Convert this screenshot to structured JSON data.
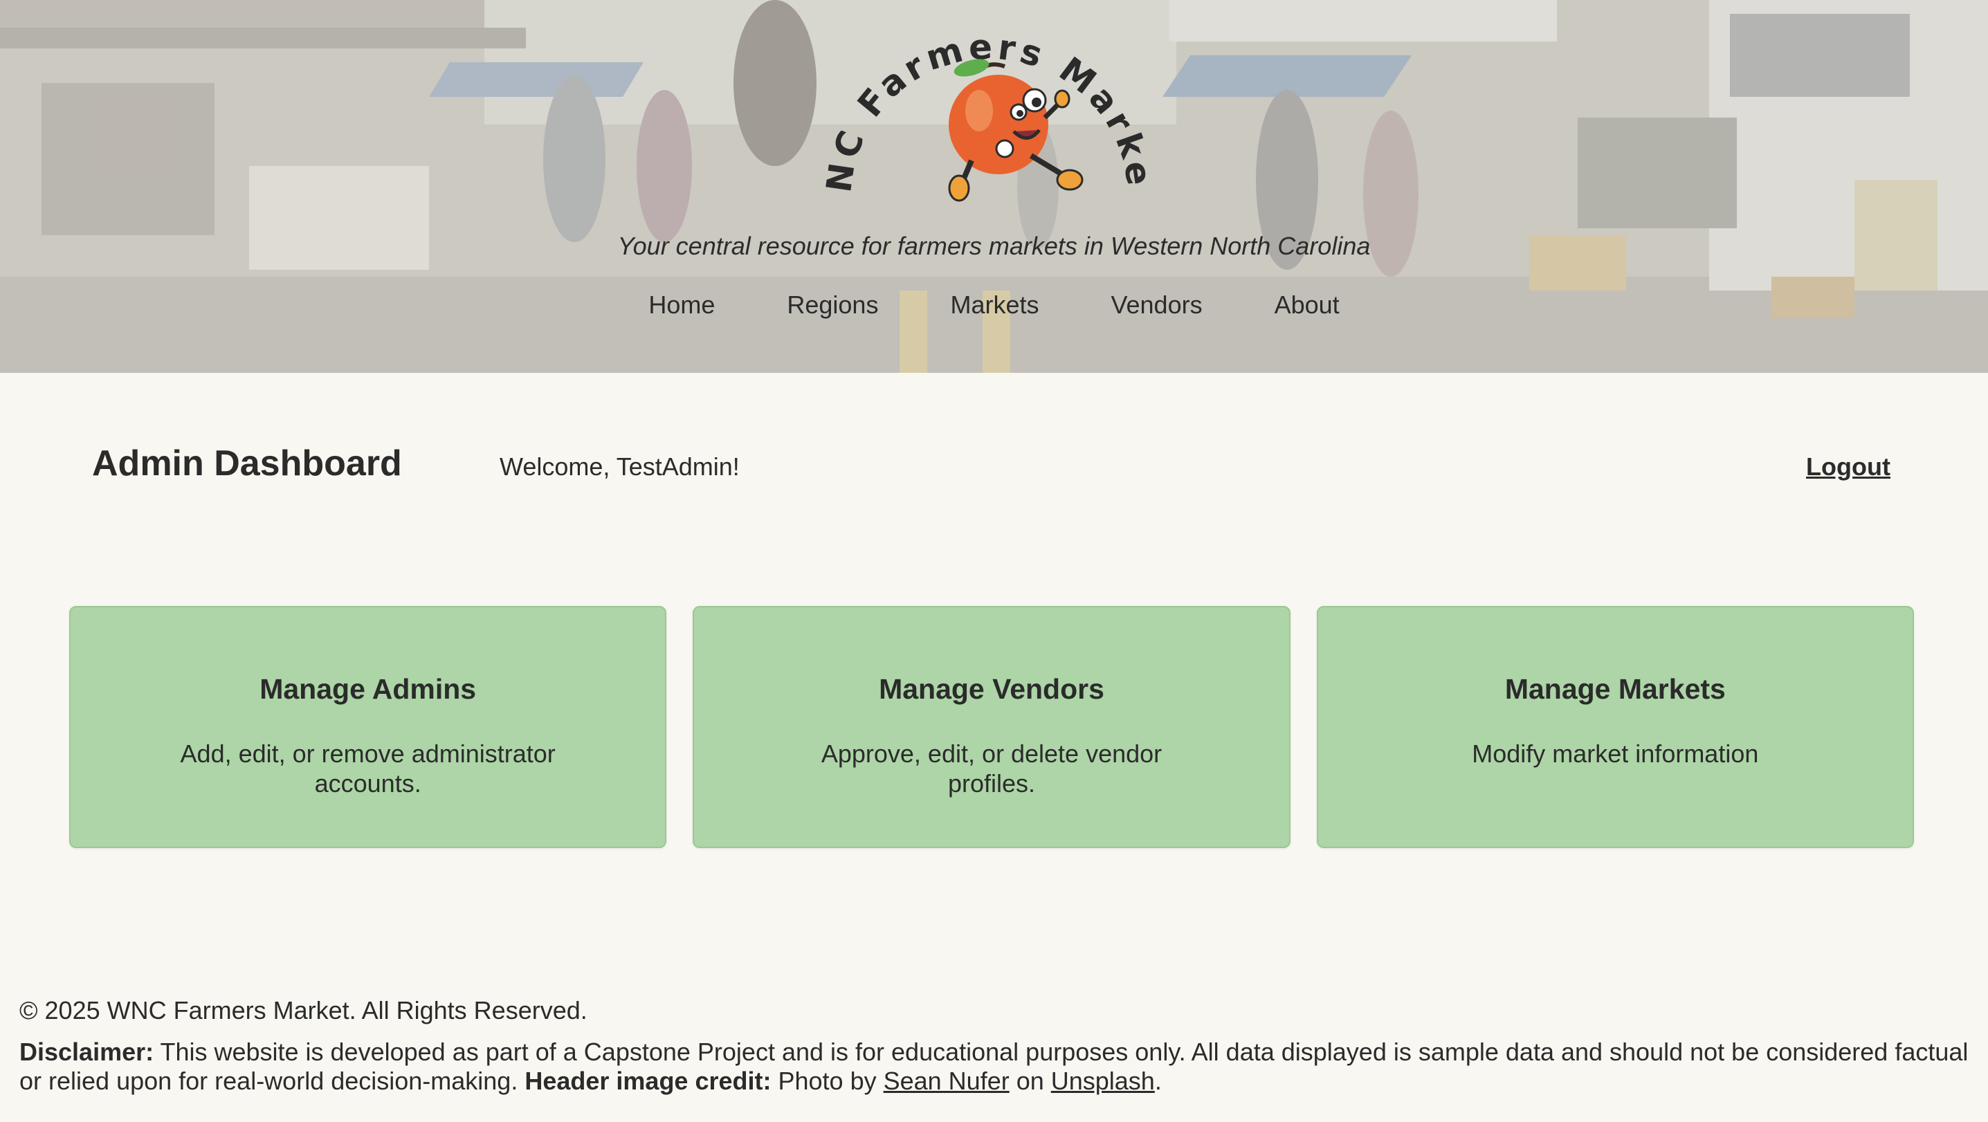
{
  "header": {
    "logo_text": "WNC Farmers Markets",
    "tagline": "Your central resource for farmers markets in Western North Carolina",
    "nav": [
      "Home",
      "Regions",
      "Markets",
      "Vendors",
      "About"
    ]
  },
  "dashboard": {
    "title": "Admin Dashboard",
    "welcome": "Welcome, TestAdmin!",
    "logout_label": "Logout"
  },
  "cards": [
    {
      "title": "Manage Admins",
      "description": "Add, edit, or remove administrator accounts."
    },
    {
      "title": "Manage Vendors",
      "description": "Approve, edit, or delete vendor profiles."
    },
    {
      "title": "Manage Markets",
      "description": "Modify market information"
    }
  ],
  "footer": {
    "copyright": "© 2025 WNC Farmers Market. All Rights Reserved.",
    "disclaimer_label": "Disclaimer:",
    "disclaimer_text": " This website is developed as part of a Capstone Project and is for educational purposes only. All data displayed is sample data and should not be considered factual or relied upon for real-world decision-making. ",
    "credit_label": "Header image credit:",
    "credit_prefix": " Photo by ",
    "photographer": "Sean Nufer",
    "credit_mid": " on ",
    "site": "Unsplash",
    "credit_end": "."
  },
  "colors": {
    "page_background": "#f9f7f1",
    "card_background": "#add5a7",
    "text": "#2b2b2b",
    "logo_orange": "#e8632f"
  }
}
